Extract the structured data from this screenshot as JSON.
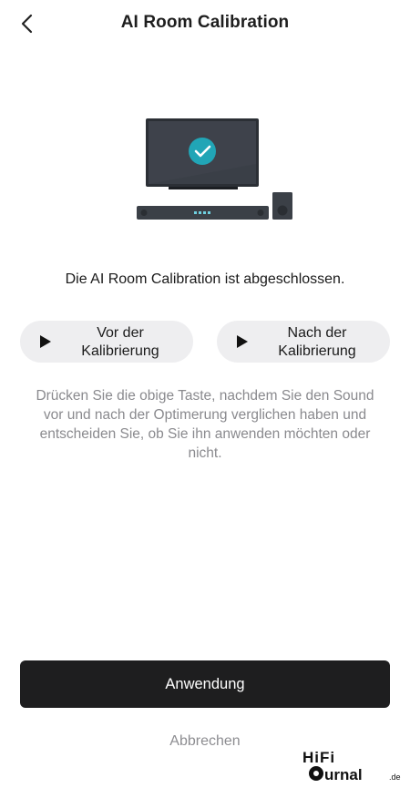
{
  "header": {
    "title": "AI Room Calibration",
    "back_icon": "chevron-left-icon"
  },
  "illustration": {
    "description_icon": "tv-soundbar-check-icon",
    "accent_color": "#21a5b6"
  },
  "status": {
    "message": "Die AI Room Calibration ist abgeschlossen."
  },
  "compare": {
    "before_label": "Vor der\nKalibrierung",
    "after_label": "Nach der\nKalibrierung",
    "play_icon": "play-icon"
  },
  "description": "Drücken Sie die obige Taste, nachdem Sie den Sound vor und nach der Optimerung verglichen haben und entscheiden Sie, ob Sie ihn anwenden möchten oder nicht.",
  "actions": {
    "apply_label": "Anwendung",
    "cancel_label": "Abbrechen"
  },
  "watermark": {
    "text": "HiFi Journal.de"
  }
}
